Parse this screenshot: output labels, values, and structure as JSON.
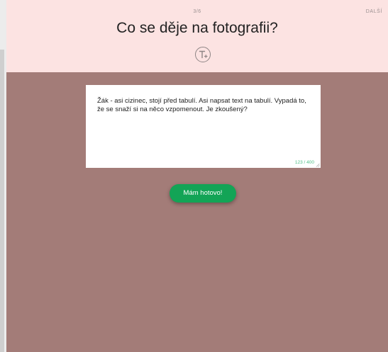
{
  "header": {
    "progress": "3/6",
    "next_label": "DALŠÍ",
    "title": "Co se děje na fotografii?"
  },
  "tools": {
    "text_tool_icon": "text-plus-icon"
  },
  "answer": {
    "value": "Žák - asi cizinec, stojí před tabulí. Asi napsat text na tabulí. Vypadá to, že se snaží si na něco vzpomenout. Je zkoušený?",
    "char_count": "123 / 400"
  },
  "actions": {
    "done_label": "Mám hotovo!"
  },
  "colors": {
    "header_bg": "#fce3e2",
    "body_bg": "#a37c78",
    "accent": "#13a456",
    "counter": "#4fbf86"
  }
}
